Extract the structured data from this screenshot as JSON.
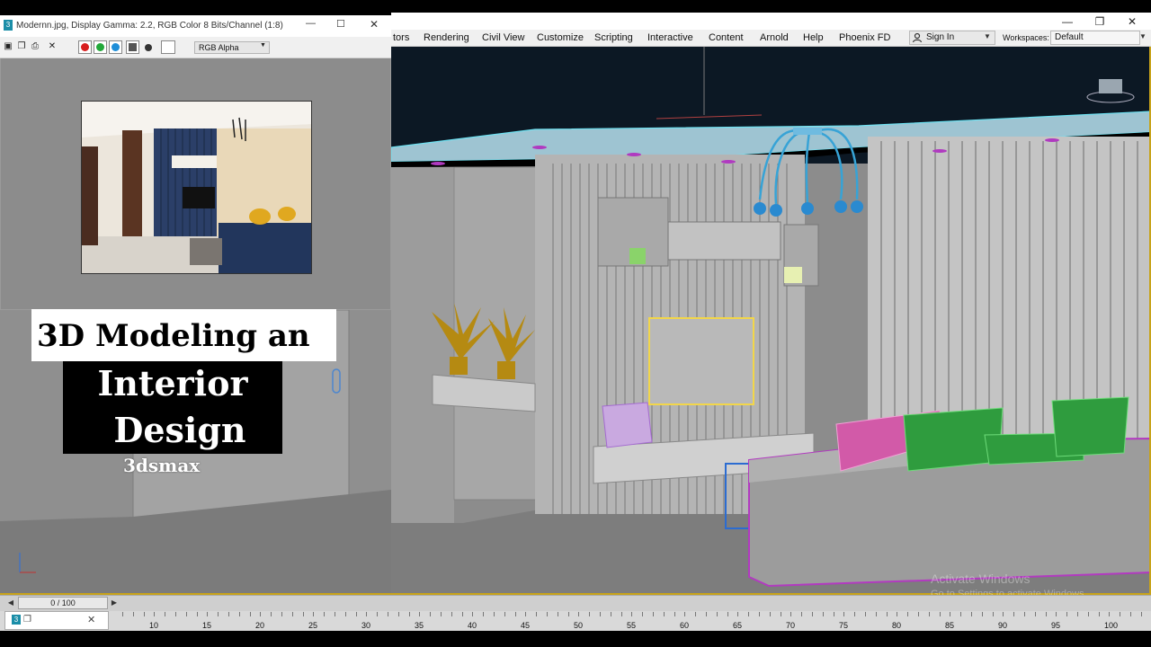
{
  "frame_window": {
    "title": "Modernn.jpg, Display Gamma: 2.2, RGB Color 8 Bits/Channel (1:8)",
    "channel_select": "RGB Alpha",
    "channel_colors": [
      "#d81e1e",
      "#22a83a",
      "#1e8ed8",
      "#555555",
      "#333333",
      "#ffffff"
    ]
  },
  "menu": {
    "items": [
      "tors",
      "Rendering",
      "Civil View",
      "Customize",
      "Scripting",
      "Interactive",
      "Content",
      "Arnold",
      "Help",
      "Phoenix FD"
    ],
    "sign_in": "Sign In",
    "workspaces_label": "Workspaces:",
    "workspace_value": "Default"
  },
  "overlay": {
    "line1": "3D Modeling an",
    "line2": "Interior",
    "line3": "Design",
    "line4": "3dsmax"
  },
  "watermark": {
    "line1": "Activate Windows",
    "line2": "Go to Settings to activate Windows."
  },
  "timeline": {
    "slider": "0 / 100",
    "ticks": [
      "10",
      "15",
      "20",
      "25",
      "30",
      "35",
      "40",
      "45",
      "50",
      "55",
      "60",
      "65",
      "70",
      "75",
      "80",
      "85",
      "90",
      "95",
      "100"
    ]
  },
  "colors": {
    "accent_selection": "#c8a31a",
    "viewport_bg": "#8c8c8c",
    "ceiling": "#0d1a26"
  }
}
